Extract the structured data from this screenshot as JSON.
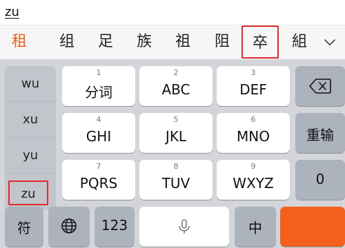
{
  "composition": {
    "text": "zu"
  },
  "candidates": {
    "items": [
      "租",
      "组",
      "足",
      "族",
      "祖",
      "阻",
      "卒",
      "組"
    ],
    "expand_icon": "chevron-down-icon"
  },
  "pinyin": {
    "items": [
      "wu",
      "xu",
      "yu",
      "zu"
    ]
  },
  "keys": {
    "k1": {
      "num": "1",
      "label": "分词"
    },
    "k2": {
      "num": "2",
      "label": "ABC"
    },
    "k3": {
      "num": "3",
      "label": "DEF"
    },
    "k4": {
      "num": "4",
      "label": "GHI"
    },
    "k5": {
      "num": "5",
      "label": "JKL"
    },
    "k6": {
      "num": "6",
      "label": "MNO"
    },
    "k7": {
      "num": "7",
      "label": "PQRS"
    },
    "k8": {
      "num": "8",
      "label": "TUV"
    },
    "k9": {
      "num": "9",
      "label": "WXYZ"
    },
    "k0": {
      "label": "0"
    },
    "reenter": {
      "label": "重输"
    },
    "delete_icon": "delete-backspace-icon"
  },
  "bottom": {
    "symbol": "符",
    "globe_icon": "globe-icon",
    "num": "123",
    "mic_icon": "microphone-icon",
    "lang": "中"
  },
  "colors": {
    "selected_candidate": "#f4601c",
    "highlight_box": "#e32a2a"
  }
}
